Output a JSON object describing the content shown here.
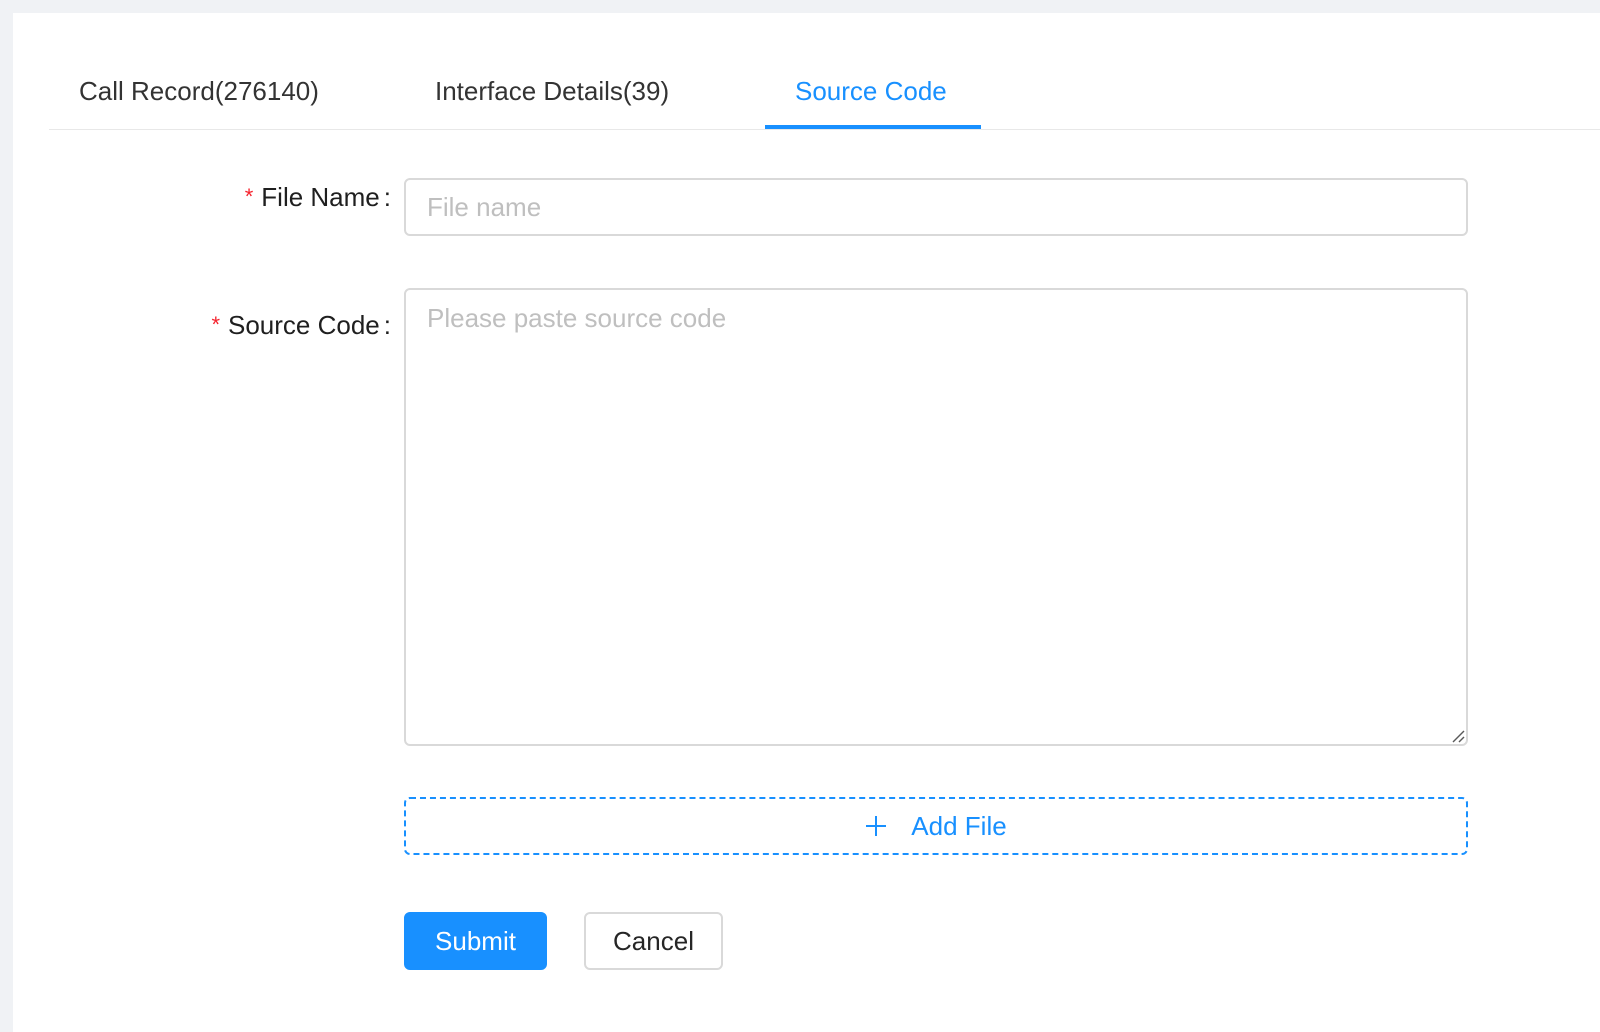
{
  "tabs": [
    {
      "label": "Call Record(276140)",
      "active": false
    },
    {
      "label": "Interface Details(39)",
      "active": false
    },
    {
      "label": "Source Code",
      "active": true
    }
  ],
  "form": {
    "required_mark": "*",
    "colon": ":",
    "file_name": {
      "label": "File Name",
      "placeholder": "File name",
      "value": ""
    },
    "source_code": {
      "label": "Source Code",
      "placeholder": "Please paste source code",
      "value": ""
    },
    "add_file_label": "Add File",
    "submit_label": "Submit",
    "cancel_label": "Cancel"
  },
  "colors": {
    "accent": "#1890ff",
    "required": "#f5222d",
    "border": "#d9d9d9",
    "placeholder": "#bfbfbf",
    "background": "#f0f2f5"
  },
  "icons": {
    "add": "plus-icon",
    "resize": "resize-handle-icon"
  }
}
